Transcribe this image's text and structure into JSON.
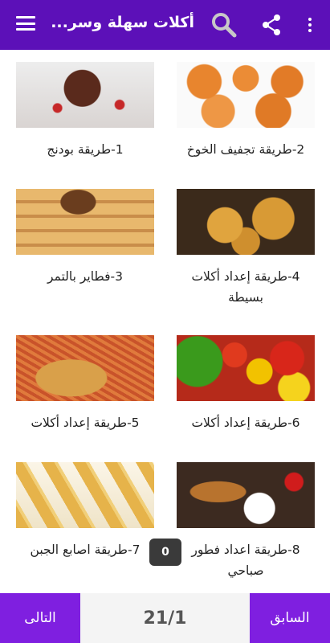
{
  "appbar": {
    "title": "أكلات سهلة وسر...",
    "more_icon": "more-vert-icon",
    "share_icon": "share-icon",
    "search_icon": "search-icon",
    "menu_icon": "menu-icon"
  },
  "recipes": [
    {
      "label": "1-طريقة بودنج",
      "image": "pudding"
    },
    {
      "label": "2-طريقة تجفيف الخوخ",
      "image": "dried-peaches"
    },
    {
      "label": "3-فطاير بالتمر",
      "image": "date-pastries"
    },
    {
      "label": "4-طريقة إعداد أكلات بسيطة",
      "image": "fried-pastries"
    },
    {
      "label": "5-طريقة إعداد أكلات",
      "image": "schnitzel-rice"
    },
    {
      "label": "6-طريقة إعداد أكلات",
      "image": "vegetables"
    },
    {
      "label": "7-طريقة اصابع الجبن",
      "image": "cheese-sticks"
    },
    {
      "label": "8-طريقة اعداد فطور صباحي",
      "image": "breakfast"
    }
  ],
  "badge": {
    "count": "0"
  },
  "footer": {
    "next_label": "التالى",
    "prev_label": "السابق",
    "page_indicator": "21/1"
  },
  "colors": {
    "appbar": "#5c10b8",
    "button": "#7f1fe0"
  }
}
